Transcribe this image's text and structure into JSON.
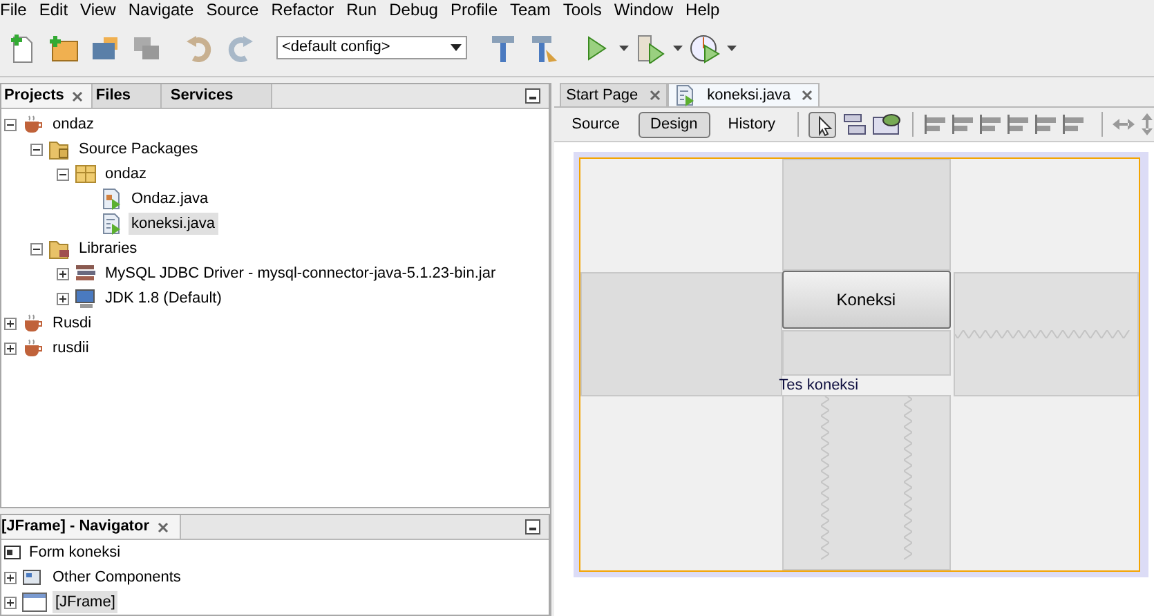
{
  "menu": [
    "File",
    "Edit",
    "View",
    "Navigate",
    "Source",
    "Refactor",
    "Run",
    "Debug",
    "Profile",
    "Team",
    "Tools",
    "Window",
    "Help"
  ],
  "toolbar": {
    "config": "<default config>"
  },
  "projects_panel": {
    "tabs": [
      {
        "label": "Projects",
        "selected": true,
        "closable": true
      },
      {
        "label": "Files",
        "selected": false,
        "closable": false
      },
      {
        "label": "Services",
        "selected": false,
        "closable": false
      }
    ],
    "tree": [
      {
        "label": "ondaz",
        "kind": "project",
        "expanded": true,
        "selected": false,
        "children": [
          {
            "label": "Source Packages",
            "kind": "sources",
            "expanded": true,
            "selected": false,
            "children": [
              {
                "label": "ondaz",
                "kind": "package",
                "expanded": true,
                "selected": false,
                "children": [
                  {
                    "label": "Ondaz.java",
                    "kind": "mainfile",
                    "selected": false
                  },
                  {
                    "label": "koneksi.java",
                    "kind": "formfile",
                    "selected": true
                  }
                ]
              }
            ]
          },
          {
            "label": "Libraries",
            "kind": "libraries",
            "expanded": true,
            "selected": false,
            "children": [
              {
                "label": "MySQL JDBC Driver - mysql-connector-java-5.1.23-bin.jar",
                "kind": "jar",
                "expanded": false,
                "selected": false
              },
              {
                "label": "JDK 1.8 (Default)",
                "kind": "jdk",
                "expanded": false,
                "selected": false
              }
            ]
          }
        ]
      },
      {
        "label": "Rusdi",
        "kind": "project",
        "expanded": false,
        "selected": false
      },
      {
        "label": "rusdii",
        "kind": "project",
        "expanded": false,
        "selected": false
      }
    ]
  },
  "navigator": {
    "title": "[JFrame] - Navigator",
    "items": [
      {
        "label": "Form koneksi",
        "kind": "form",
        "selected": false
      },
      {
        "label": "Other Components",
        "kind": "components",
        "expanded": false,
        "selected": false
      },
      {
        "label": "[JFrame]",
        "kind": "frame",
        "expanded": false,
        "selected": true
      }
    ]
  },
  "editor": {
    "tabs": [
      {
        "label": "Start Page",
        "selected": false
      },
      {
        "label": "koneksi.java",
        "selected": true
      }
    ],
    "views": [
      {
        "label": "Source",
        "selected": false
      },
      {
        "label": "Design",
        "selected": true
      },
      {
        "label": "History",
        "selected": false
      }
    ],
    "form": {
      "button": "Koneksi",
      "label": "Tes koneksi"
    }
  }
}
